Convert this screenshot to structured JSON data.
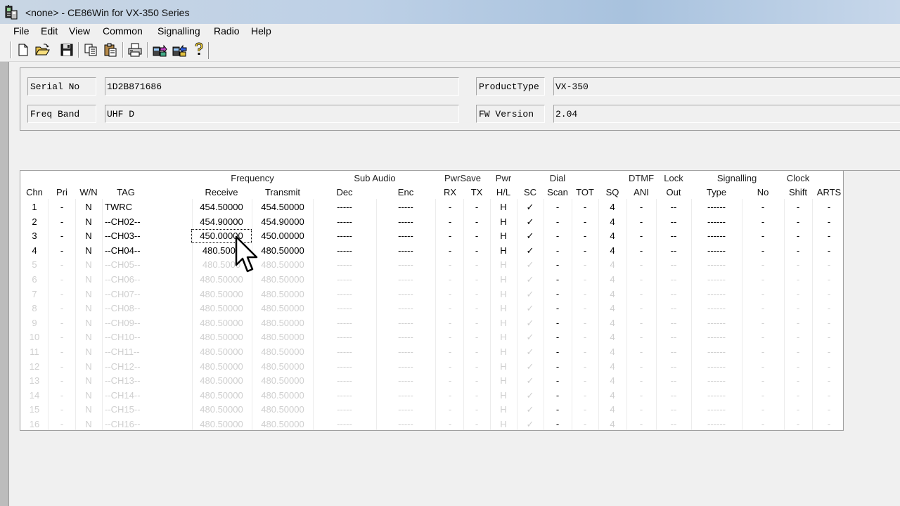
{
  "window": {
    "title": "<none> - CE86Win for VX-350 Series"
  },
  "menu": [
    "File",
    "Edit",
    "View",
    "Common",
    "Signalling",
    "Radio",
    "Help"
  ],
  "toolbar": {
    "buttons": [
      "new-icon",
      "open-icon",
      "save-icon",
      "copy-icon",
      "paste-icon",
      "print-icon",
      "read-radio-icon",
      "write-radio-icon",
      "help-icon"
    ]
  },
  "info": {
    "serial_label": "Serial No",
    "serial_value": "1D2B871686",
    "product_label": "ProductType",
    "product_value": "VX-350",
    "band_label": "Freq Band",
    "band_value": "UHF D",
    "fw_label": "FW Version",
    "fw_value": "2.04"
  },
  "grid": {
    "groups": [
      "Frequency",
      "Sub Audio",
      "PwrSave",
      "Pwr",
      "Dial",
      "DTMF",
      "Lock",
      "Signalling",
      "Clock"
    ],
    "columns": [
      "Chn",
      "Pri",
      "W/N",
      "TAG",
      "Receive",
      "Transmit",
      "Dec",
      "Enc",
      "RX",
      "TX",
      "H/L",
      "SC",
      "Scan",
      "TOT",
      "SQ",
      "ANI",
      "Out",
      "Type",
      "No",
      "Shift",
      "ARTS"
    ],
    "rows": [
      [
        "1",
        "-",
        "N",
        "TWRC",
        "454.50000",
        "454.50000",
        "-----",
        "-----",
        "-",
        "-",
        "H",
        "✓",
        "-",
        "-",
        "4",
        "-",
        "--",
        "------",
        "-",
        "-",
        "-"
      ],
      [
        "2",
        "-",
        "N",
        "--CH02--",
        "454.90000",
        "454.90000",
        "-----",
        "-----",
        "-",
        "-",
        "H",
        "✓",
        "-",
        "-",
        "4",
        "-",
        "--",
        "------",
        "-",
        "-",
        "-"
      ],
      [
        "3",
        "-",
        "N",
        "--CH03--",
        "450.00000",
        "450.00000",
        "-----",
        "-----",
        "-",
        "-",
        "H",
        "✓",
        "-",
        "-",
        "4",
        "-",
        "--",
        "------",
        "-",
        "-",
        "-"
      ],
      [
        "4",
        "-",
        "N",
        "--CH04--",
        "480.5000",
        "480.50000",
        "-----",
        "-----",
        "-",
        "-",
        "H",
        "✓",
        "-",
        "-",
        "4",
        "-",
        "--",
        "------",
        "-",
        "-",
        "-"
      ],
      [
        "5",
        "-",
        "N",
        "--CH05--",
        "480.5000",
        "480.50000",
        "-----",
        "-----",
        "-",
        "-",
        "H",
        "✓",
        "-",
        "-",
        "4",
        "-",
        "--",
        "------",
        "-",
        "-",
        "-"
      ],
      [
        "6",
        "-",
        "N",
        "--CH06--",
        "480.50000",
        "480.50000",
        "-----",
        "-----",
        "-",
        "-",
        "H",
        "✓",
        "-",
        "-",
        "4",
        "-",
        "--",
        "------",
        "-",
        "-",
        "-"
      ],
      [
        "7",
        "-",
        "N",
        "--CH07--",
        "480.50000",
        "480.50000",
        "-----",
        "-----",
        "-",
        "-",
        "H",
        "✓",
        "-",
        "-",
        "4",
        "-",
        "--",
        "------",
        "-",
        "-",
        "-"
      ],
      [
        "8",
        "-",
        "N",
        "--CH08--",
        "480.50000",
        "480.50000",
        "-----",
        "-----",
        "-",
        "-",
        "H",
        "✓",
        "-",
        "-",
        "4",
        "-",
        "--",
        "------",
        "-",
        "-",
        "-"
      ],
      [
        "9",
        "-",
        "N",
        "--CH09--",
        "480.50000",
        "480.50000",
        "-----",
        "-----",
        "-",
        "-",
        "H",
        "✓",
        "-",
        "-",
        "4",
        "-",
        "--",
        "------",
        "-",
        "-",
        "-"
      ],
      [
        "10",
        "-",
        "N",
        "--CH10--",
        "480.50000",
        "480.50000",
        "-----",
        "-----",
        "-",
        "-",
        "H",
        "✓",
        "-",
        "-",
        "4",
        "-",
        "--",
        "------",
        "-",
        "-",
        "-"
      ],
      [
        "11",
        "-",
        "N",
        "--CH11--",
        "480.50000",
        "480.50000",
        "-----",
        "-----",
        "-",
        "-",
        "H",
        "✓",
        "-",
        "-",
        "4",
        "-",
        "--",
        "------",
        "-",
        "-",
        "-"
      ],
      [
        "12",
        "-",
        "N",
        "--CH12--",
        "480.50000",
        "480.50000",
        "-----",
        "-----",
        "-",
        "-",
        "H",
        "✓",
        "-",
        "-",
        "4",
        "-",
        "--",
        "------",
        "-",
        "-",
        "-"
      ],
      [
        "13",
        "-",
        "N",
        "--CH13--",
        "480.50000",
        "480.50000",
        "-----",
        "-----",
        "-",
        "-",
        "H",
        "✓",
        "-",
        "-",
        "4",
        "-",
        "--",
        "------",
        "-",
        "-",
        "-"
      ],
      [
        "14",
        "-",
        "N",
        "--CH14--",
        "480.50000",
        "480.50000",
        "-----",
        "-----",
        "-",
        "-",
        "H",
        "✓",
        "-",
        "-",
        "4",
        "-",
        "--",
        "------",
        "-",
        "-",
        "-"
      ],
      [
        "15",
        "-",
        "N",
        "--CH15--",
        "480.50000",
        "480.50000",
        "-----",
        "-----",
        "-",
        "-",
        "H",
        "✓",
        "-",
        "-",
        "4",
        "-",
        "--",
        "------",
        "-",
        "-",
        "-"
      ],
      [
        "16",
        "-",
        "N",
        "--CH16--",
        "480.50000",
        "480.50000",
        "-----",
        "-----",
        "-",
        "-",
        "H",
        "✓",
        "-",
        "-",
        "4",
        "-",
        "--",
        "------",
        "-",
        "-",
        "-"
      ]
    ],
    "active_rows": 4,
    "selected_cell": {
      "row": 3,
      "column": "Receive"
    }
  },
  "colors": {
    "window_bg": "#f0f0f0",
    "workspace_bg": "#bcbcbc",
    "grid_bg": "#ffffff",
    "inactive_text": "#cfcfcf",
    "title_gradient": "#bdd0e6"
  }
}
